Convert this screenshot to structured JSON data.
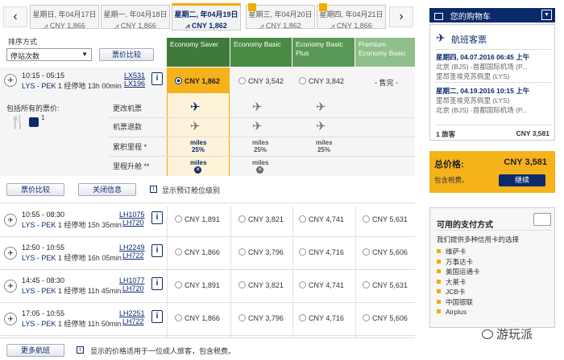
{
  "dates": {
    "prev_arrow": "‹",
    "next_arrow": "›",
    "tabs": [
      {
        "date": "星期日, 年04月17日",
        "price": "CNY 1,866"
      },
      {
        "date": "星期一, 年04月18日",
        "price": "CNY 1,866"
      },
      {
        "date": "星期二, 年04月19日",
        "price": "CNY 1,862"
      },
      {
        "date": "星期三, 年04月20日",
        "price": "CNY 1,862"
      },
      {
        "date": "星期四, 年04月21日",
        "price": "CNY 1,866"
      }
    ]
  },
  "sort": {
    "label": "排序方式",
    "value": "停站次数",
    "compare_btn": "票价比较"
  },
  "fare_columns": [
    {
      "label": "Economy Saver",
      "color": "#3f7a3a"
    },
    {
      "label": "Economy Basic",
      "color": "#4a8a45"
    },
    {
      "label": "Economy Basic Plus",
      "color": "#5a9955"
    },
    {
      "label": "Premium Economy Basic",
      "color": "#8fbf8a"
    }
  ],
  "selected_flight": {
    "time": "10:15 - 05:15",
    "route": "LYS - PEK",
    "stops": "1 经停地",
    "duration": "13h 00min",
    "flight1": "LX531",
    "flight2": "LX196",
    "info": "i",
    "prices": [
      "CNY 1,862",
      "CNY 3,542",
      "CNY 3,842",
      "- 售完 -"
    ]
  },
  "included": {
    "label": "包括所有的票价:",
    "count": "1",
    "rows": [
      {
        "label": "更改机票"
      },
      {
        "label": "机票退款"
      },
      {
        "label": "累积里程 *",
        "values": [
          "miles 25%",
          "miles 25%",
          "miles 25%"
        ]
      },
      {
        "label": "里程升舱 **",
        "values": [
          "miles",
          "miles"
        ]
      }
    ]
  },
  "actions": {
    "compare": "票价比较",
    "close": "关闭信息",
    "show_booking": "显示预订舱位级别"
  },
  "flights": [
    {
      "time": "10:55 - 08:30",
      "route": "LYS - PEK",
      "stops": "1 经停地",
      "duration": "15h 35min",
      "f1": "LH1075",
      "f2": "LH720",
      "prices": [
        "CNY 1,891",
        "CNY 3,821",
        "CNY 4,741",
        "CNY 5,631"
      ]
    },
    {
      "time": "12:50 - 10:55",
      "route": "LYS - PEK",
      "stops": "1 经停地",
      "duration": "16h 05min",
      "f1": "LH2249",
      "f2": "LH722",
      "prices": [
        "CNY 1,866",
        "CNY 3,796",
        "CNY 4,716",
        "CNY 5,606"
      ]
    },
    {
      "time": "14:45 - 08:30",
      "route": "LYS - PEK",
      "stops": "1 经停地",
      "duration": "11h 45min",
      "f1": "LH1077",
      "f2": "LH720",
      "prices": [
        "CNY 1,891",
        "CNY 3,821",
        "CNY 4,741",
        "CNY 5,631"
      ]
    },
    {
      "time": "17:05 - 10:55",
      "route": "LYS - PEK",
      "stops": "1 经停地",
      "duration": "11h 50min",
      "f1": "LH2251",
      "f2": "LH722",
      "prices": [
        "CNY 1,866",
        "CNY 3,796",
        "CNY 4,716",
        "CNY 5,606"
      ]
    }
  ],
  "more_flights": "更多航班",
  "footnote": "显示的价格适用于一位成人旅客，包含税费。",
  "cart": {
    "title": "您的购物车",
    "section": "航班客票",
    "seg1_date": "星期四, 04.07.2016 06:45 上午",
    "seg1_from": "北京 (BJS) -首都国际机场 (P...",
    "seg1_to": "里昂圣埃克苏佩里 (LYS)",
    "seg2_date": "星期二, 04.19.2016 10:15 上午",
    "seg2_from": "里昂圣埃克苏佩里 (LYS)",
    "seg2_to": "北京 (BJS) -首都国际机场 (P...",
    "pax": "1 旅客",
    "pax_price": "CNY 3,581",
    "total_label": "总价格:",
    "total": "CNY 3,581",
    "tax": "包含税费。",
    "continue": "继续"
  },
  "payment": {
    "title": "可用的支付方式",
    "intro": "我们提供多种信用卡的选择",
    "cards": [
      "维萨卡",
      "万事达卡",
      "美国运通卡",
      "大莱卡",
      "JCB卡",
      "中国银联",
      "Airplus"
    ]
  },
  "watermark": "游玩派"
}
